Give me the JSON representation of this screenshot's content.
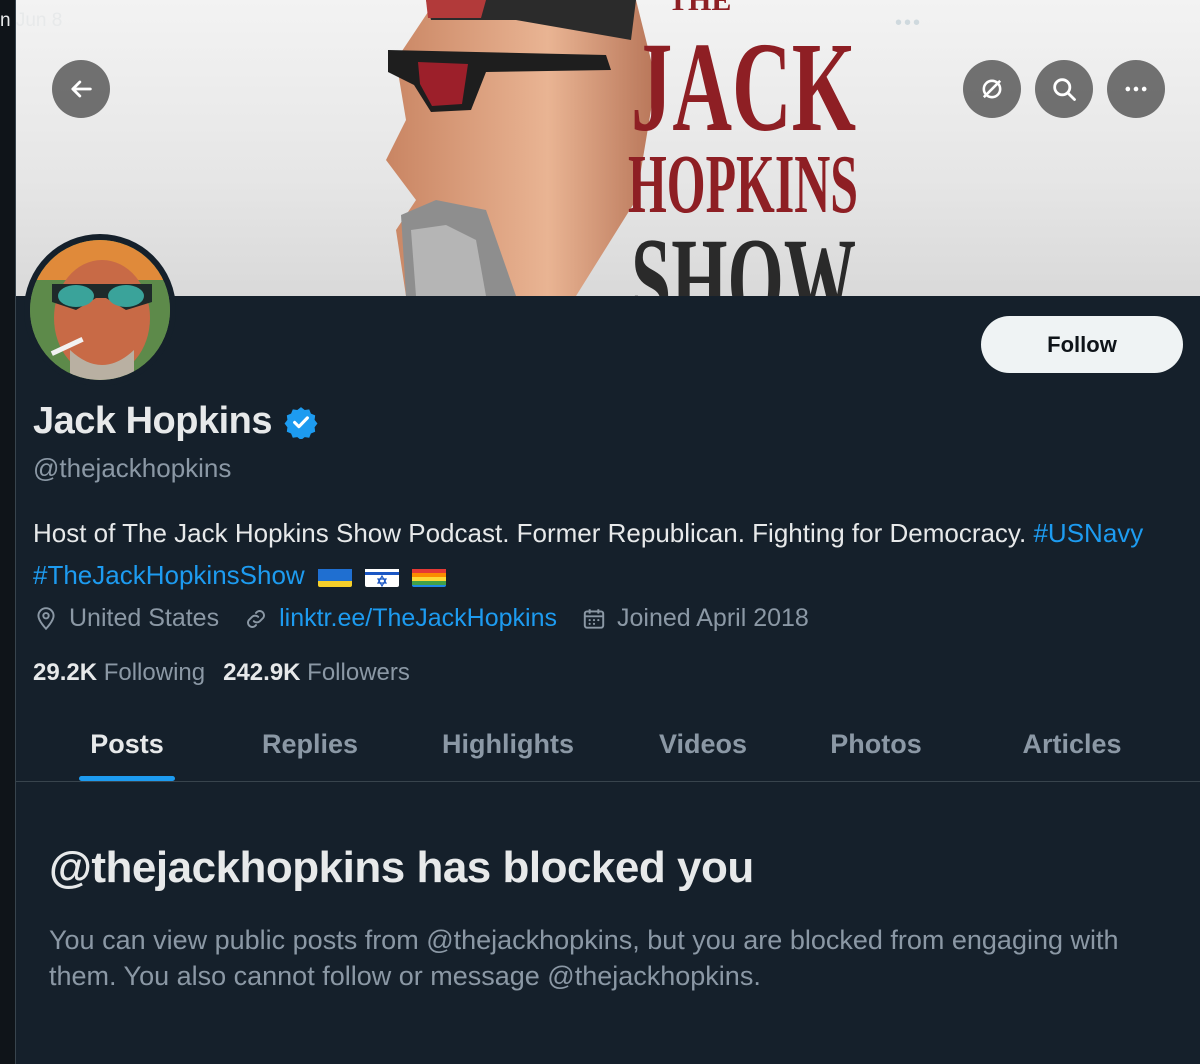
{
  "status": {
    "date": "n Jun 8",
    "dots": "•••"
  },
  "banner": {
    "title_line1": "JACK",
    "title_line2": "HOPKINS",
    "title_line3": "SHOW",
    "title_top": "THE"
  },
  "profile": {
    "name": "Jack Hopkins",
    "handle": "@thejackhopkins",
    "bio_text": "Host of The Jack Hopkins Show Podcast. Former Republican. Fighting for Democracy.",
    "bio_tag1": "#USNavy",
    "bio_tag2": "#TheJackHopkinsShow",
    "location": "United States",
    "website": "linktr.ee/TheJackHopkins",
    "joined": "Joined April 2018",
    "following_count": "29.2K",
    "following_label": "Following",
    "followers_count": "242.9K",
    "followers_label": "Followers",
    "follow_label": "Follow"
  },
  "tabs": [
    "Posts",
    "Replies",
    "Highlights",
    "Videos",
    "Photos",
    "Articles"
  ],
  "active_tab": "Posts",
  "blocked": {
    "title": "@thejackhopkins has blocked you",
    "message": "You can view public posts from @thejackhopkins, but you are blocked from engaging with them. You also cannot follow or message @thejackhopkins."
  },
  "colors": {
    "background": "#15202b",
    "accent": "#1d9bf0",
    "muted": "#8b98a5",
    "text": "#e7e9ea"
  },
  "icons": [
    "back-arrow-icon",
    "translate-icon",
    "search-icon",
    "more-icon",
    "verified-badge-icon",
    "location-icon",
    "link-icon",
    "calendar-icon"
  ]
}
